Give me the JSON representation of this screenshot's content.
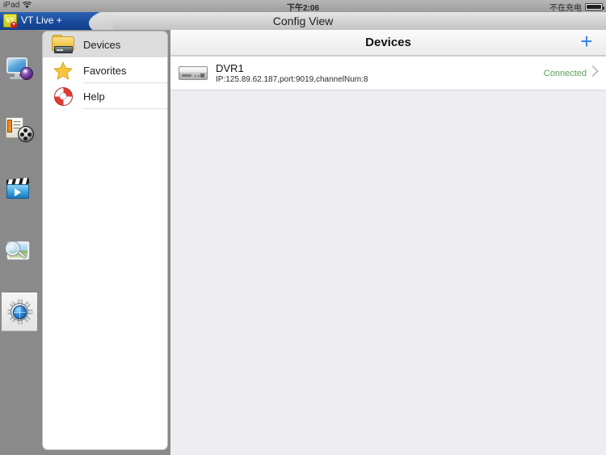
{
  "status_bar": {
    "device_label": "iPad",
    "wifi_icon": "wifi-icon",
    "time": "下午2:06",
    "battery_text": "不在充电",
    "battery_icon": "battery-full-icon"
  },
  "nav_bar": {
    "app_tab_logo_text": "VT",
    "app_tab_badge": "+",
    "app_tab_label": "VT Live +",
    "title": "Config View"
  },
  "dock": {
    "items": [
      {
        "name": "live-view",
        "icon": "monitor-camera-icon",
        "selected": false
      },
      {
        "name": "media-library",
        "icon": "film-reel-icon",
        "selected": false
      },
      {
        "name": "playback",
        "icon": "clapperboard-play-icon",
        "selected": false
      },
      {
        "name": "image-browser",
        "icon": "photo-magnifier-icon",
        "selected": false
      },
      {
        "name": "settings",
        "icon": "gear-globe-icon",
        "selected": true
      }
    ]
  },
  "menu": {
    "items": [
      {
        "label": "Devices",
        "icon": "folder-device-icon",
        "active": true
      },
      {
        "label": "Favorites",
        "icon": "star-icon",
        "active": false
      },
      {
        "label": "Help",
        "icon": "life-ring-icon",
        "active": false
      }
    ]
  },
  "content": {
    "title": "Devices",
    "add_label": "+",
    "devices": [
      {
        "icon": "dvr-device-icon",
        "name": "DVR1",
        "details": "IP:125.89.62.187,port:9019,channelNum:8",
        "status": "Connected",
        "status_color": "#5b9e5b",
        "chevron": "chevron-right-icon"
      }
    ]
  },
  "colors": {
    "accent_blue": "#2c7ef0",
    "status_green": "#5b9e5b",
    "desktop_gray": "#8a8a8a",
    "content_bg": "#eeeef2",
    "tab_blue": "#1b4c9c"
  }
}
